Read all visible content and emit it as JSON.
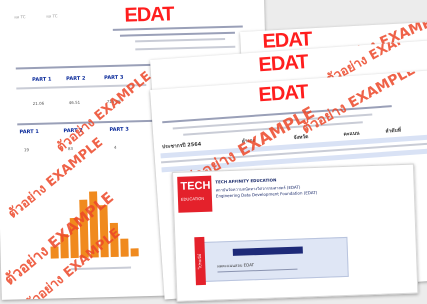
{
  "logo_text": "EDAT",
  "watermark_text": "ตัวอย่าง EXAMPLE",
  "back_page": {
    "corner_label_left": "ผล TC",
    "corner_label_mid": "ผล TC",
    "part_headers": [
      "PART 1",
      "PART 2",
      "PART 3"
    ],
    "part_values_row1": [
      "21.06",
      "46.51",
      "715.08"
    ],
    "part_values_row2": [
      "19",
      "83",
      "4"
    ]
  },
  "middle_page": {
    "col_headers": [
      "ประชากรปี 2564",
      "อำเภอ",
      "จังหวัด",
      "คะแนน",
      "ลำดับที่"
    ]
  },
  "envelope": {
    "brand_top": "TECH",
    "brand_bottom": "EDUCATION",
    "org_line1": "TECH AFFINITY EDUCATION",
    "org_line2": "สถาบันวัดความถนัดทางวิศวกรรมศาสตร์ (EDAT)",
    "org_line3": "Engineering Data Development Foundation (EDAT)",
    "address_line": "ผลคะแนนสอบ EDAT",
    "side_label": "ไปรษณีย์",
    "colors": {
      "brand_red": "#e4212b",
      "window_blue": "#dfe6f5"
    }
  }
}
